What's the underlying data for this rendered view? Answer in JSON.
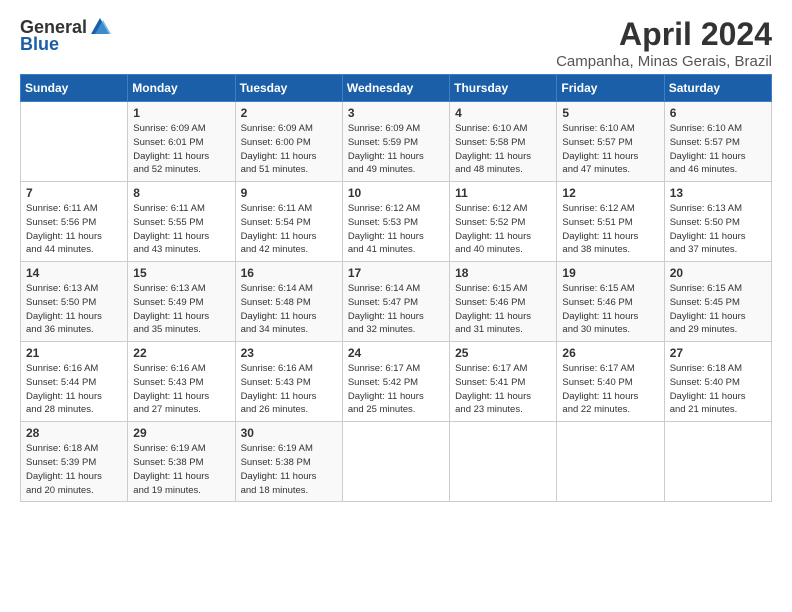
{
  "logo": {
    "general": "General",
    "blue": "Blue"
  },
  "title": "April 2024",
  "location": "Campanha, Minas Gerais, Brazil",
  "days_of_week": [
    "Sunday",
    "Monday",
    "Tuesday",
    "Wednesday",
    "Thursday",
    "Friday",
    "Saturday"
  ],
  "weeks": [
    [
      {
        "day": "",
        "info": ""
      },
      {
        "day": "1",
        "info": "Sunrise: 6:09 AM\nSunset: 6:01 PM\nDaylight: 11 hours\nand 52 minutes."
      },
      {
        "day": "2",
        "info": "Sunrise: 6:09 AM\nSunset: 6:00 PM\nDaylight: 11 hours\nand 51 minutes."
      },
      {
        "day": "3",
        "info": "Sunrise: 6:09 AM\nSunset: 5:59 PM\nDaylight: 11 hours\nand 49 minutes."
      },
      {
        "day": "4",
        "info": "Sunrise: 6:10 AM\nSunset: 5:58 PM\nDaylight: 11 hours\nand 48 minutes."
      },
      {
        "day": "5",
        "info": "Sunrise: 6:10 AM\nSunset: 5:57 PM\nDaylight: 11 hours\nand 47 minutes."
      },
      {
        "day": "6",
        "info": "Sunrise: 6:10 AM\nSunset: 5:57 PM\nDaylight: 11 hours\nand 46 minutes."
      }
    ],
    [
      {
        "day": "7",
        "info": "Sunrise: 6:11 AM\nSunset: 5:56 PM\nDaylight: 11 hours\nand 44 minutes."
      },
      {
        "day": "8",
        "info": "Sunrise: 6:11 AM\nSunset: 5:55 PM\nDaylight: 11 hours\nand 43 minutes."
      },
      {
        "day": "9",
        "info": "Sunrise: 6:11 AM\nSunset: 5:54 PM\nDaylight: 11 hours\nand 42 minutes."
      },
      {
        "day": "10",
        "info": "Sunrise: 6:12 AM\nSunset: 5:53 PM\nDaylight: 11 hours\nand 41 minutes."
      },
      {
        "day": "11",
        "info": "Sunrise: 6:12 AM\nSunset: 5:52 PM\nDaylight: 11 hours\nand 40 minutes."
      },
      {
        "day": "12",
        "info": "Sunrise: 6:12 AM\nSunset: 5:51 PM\nDaylight: 11 hours\nand 38 minutes."
      },
      {
        "day": "13",
        "info": "Sunrise: 6:13 AM\nSunset: 5:50 PM\nDaylight: 11 hours\nand 37 minutes."
      }
    ],
    [
      {
        "day": "14",
        "info": "Sunrise: 6:13 AM\nSunset: 5:50 PM\nDaylight: 11 hours\nand 36 minutes."
      },
      {
        "day": "15",
        "info": "Sunrise: 6:13 AM\nSunset: 5:49 PM\nDaylight: 11 hours\nand 35 minutes."
      },
      {
        "day": "16",
        "info": "Sunrise: 6:14 AM\nSunset: 5:48 PM\nDaylight: 11 hours\nand 34 minutes."
      },
      {
        "day": "17",
        "info": "Sunrise: 6:14 AM\nSunset: 5:47 PM\nDaylight: 11 hours\nand 32 minutes."
      },
      {
        "day": "18",
        "info": "Sunrise: 6:15 AM\nSunset: 5:46 PM\nDaylight: 11 hours\nand 31 minutes."
      },
      {
        "day": "19",
        "info": "Sunrise: 6:15 AM\nSunset: 5:46 PM\nDaylight: 11 hours\nand 30 minutes."
      },
      {
        "day": "20",
        "info": "Sunrise: 6:15 AM\nSunset: 5:45 PM\nDaylight: 11 hours\nand 29 minutes."
      }
    ],
    [
      {
        "day": "21",
        "info": "Sunrise: 6:16 AM\nSunset: 5:44 PM\nDaylight: 11 hours\nand 28 minutes."
      },
      {
        "day": "22",
        "info": "Sunrise: 6:16 AM\nSunset: 5:43 PM\nDaylight: 11 hours\nand 27 minutes."
      },
      {
        "day": "23",
        "info": "Sunrise: 6:16 AM\nSunset: 5:43 PM\nDaylight: 11 hours\nand 26 minutes."
      },
      {
        "day": "24",
        "info": "Sunrise: 6:17 AM\nSunset: 5:42 PM\nDaylight: 11 hours\nand 25 minutes."
      },
      {
        "day": "25",
        "info": "Sunrise: 6:17 AM\nSunset: 5:41 PM\nDaylight: 11 hours\nand 23 minutes."
      },
      {
        "day": "26",
        "info": "Sunrise: 6:17 AM\nSunset: 5:40 PM\nDaylight: 11 hours\nand 22 minutes."
      },
      {
        "day": "27",
        "info": "Sunrise: 6:18 AM\nSunset: 5:40 PM\nDaylight: 11 hours\nand 21 minutes."
      }
    ],
    [
      {
        "day": "28",
        "info": "Sunrise: 6:18 AM\nSunset: 5:39 PM\nDaylight: 11 hours\nand 20 minutes."
      },
      {
        "day": "29",
        "info": "Sunrise: 6:19 AM\nSunset: 5:38 PM\nDaylight: 11 hours\nand 19 minutes."
      },
      {
        "day": "30",
        "info": "Sunrise: 6:19 AM\nSunset: 5:38 PM\nDaylight: 11 hours\nand 18 minutes."
      },
      {
        "day": "",
        "info": ""
      },
      {
        "day": "",
        "info": ""
      },
      {
        "day": "",
        "info": ""
      },
      {
        "day": "",
        "info": ""
      }
    ]
  ]
}
